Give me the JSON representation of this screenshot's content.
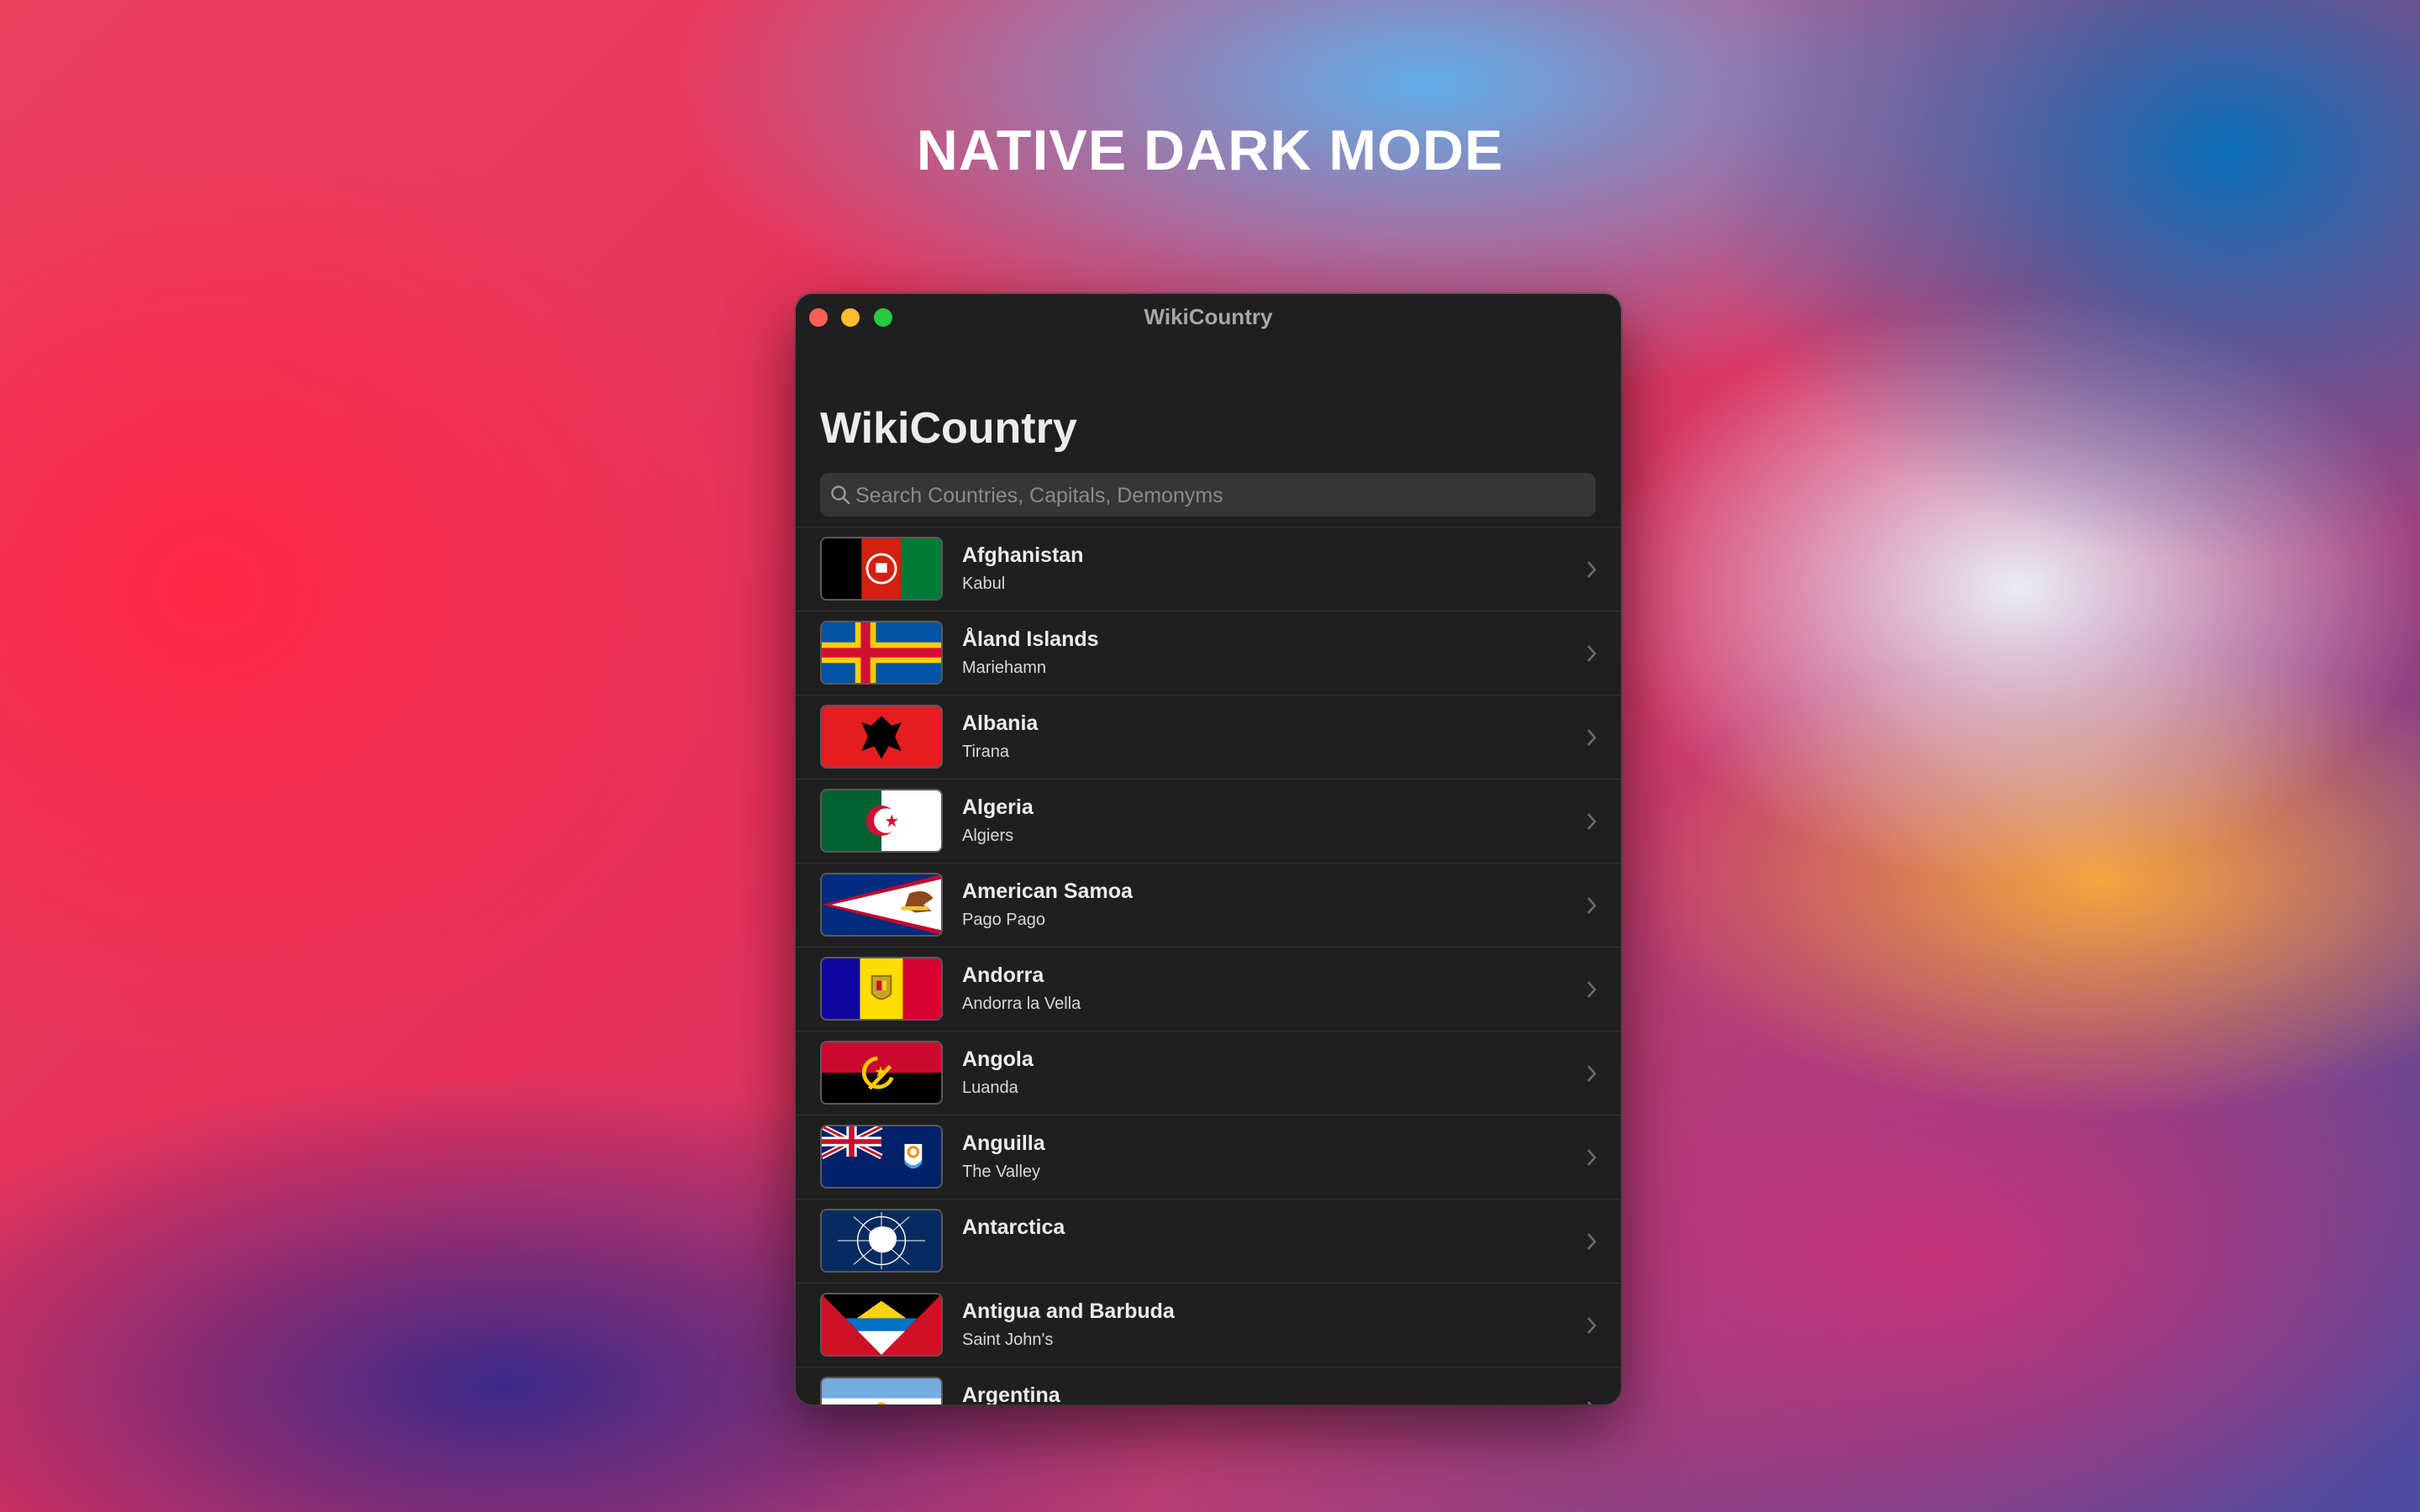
{
  "headline": "NATIVE DARK MODE",
  "window": {
    "title": "WikiCountry"
  },
  "app": {
    "title": "WikiCountry",
    "search_placeholder": "Search Countries, Capitals, Demonyms"
  },
  "countries": [
    {
      "name": "Afghanistan",
      "capital": "Kabul",
      "flag": "afghanistan-flag-icon"
    },
    {
      "name": "Åland Islands",
      "capital": "Mariehamn",
      "flag": "aland-flag-icon"
    },
    {
      "name": "Albania",
      "capital": "Tirana",
      "flag": "albania-flag-icon"
    },
    {
      "name": "Algeria",
      "capital": "Algiers",
      "flag": "algeria-flag-icon"
    },
    {
      "name": "American Samoa",
      "capital": "Pago Pago",
      "flag": "american-samoa-flag-icon"
    },
    {
      "name": "Andorra",
      "capital": "Andorra la Vella",
      "flag": "andorra-flag-icon"
    },
    {
      "name": "Angola",
      "capital": "Luanda",
      "flag": "angola-flag-icon"
    },
    {
      "name": "Anguilla",
      "capital": "The Valley",
      "flag": "anguilla-flag-icon"
    },
    {
      "name": "Antarctica",
      "capital": "",
      "flag": "antarctica-flag-icon"
    },
    {
      "name": "Antigua and Barbuda",
      "capital": "Saint John's",
      "flag": "antigua-flag-icon"
    },
    {
      "name": "Argentina",
      "capital": "",
      "flag": "argentina-flag-icon"
    }
  ]
}
